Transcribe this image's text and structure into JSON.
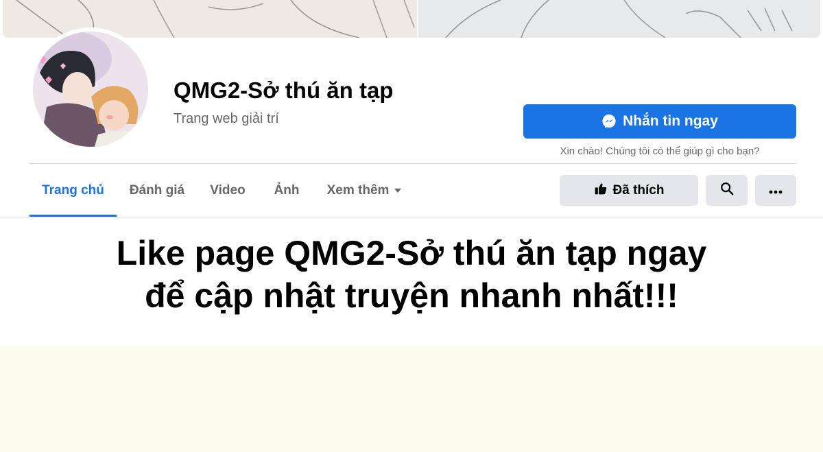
{
  "page": {
    "name": "QMG2-Sở thú ăn tạp",
    "category": "Trang web giải trí"
  },
  "actions": {
    "message_label": "Nhắn tin ngay",
    "greeting": "Xin chào! Chúng tôi có thể giúp gì cho bạn?",
    "liked_label": "Đã thích"
  },
  "tabs": [
    {
      "label": "Trang chủ",
      "active": true
    },
    {
      "label": "Đánh giá",
      "active": false
    },
    {
      "label": "Video",
      "active": false
    },
    {
      "label": "Ảnh",
      "active": false
    },
    {
      "label": "Xem thêm",
      "active": false
    }
  ],
  "promo": {
    "line1": "Like page QMG2-Sở thú ăn tạp ngay",
    "line2": "để cập nhật truyện nhanh nhất!!!"
  },
  "icons": {
    "message": "messenger-icon",
    "liked": "thumbs-up-icon",
    "search": "search-icon",
    "more": "more-icon",
    "dropdown": "chevron-down-icon"
  },
  "colors": {
    "accent": "#1b74e4",
    "secondary_text": "#65676b",
    "button_gray": "#e4e6eb",
    "cream_background": "#fbfcee"
  }
}
